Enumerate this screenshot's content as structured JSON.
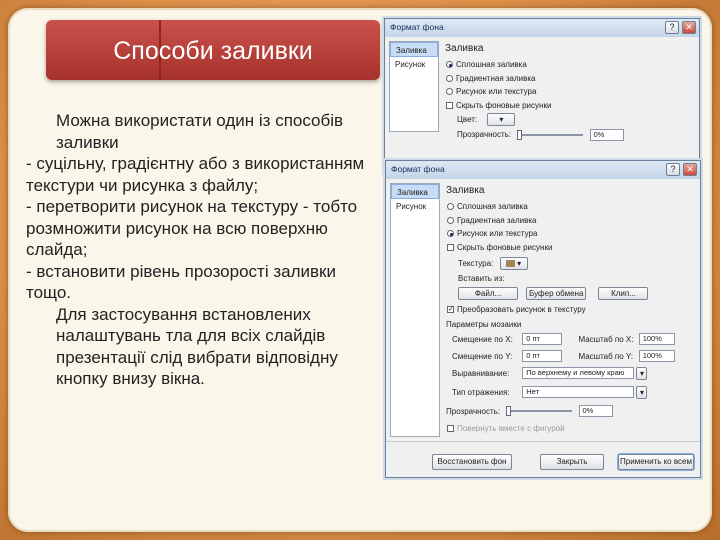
{
  "slide": {
    "title": "Способи заливки",
    "paragraphs": [
      "Можна використати один із способів заливки",
      "- суцільну, градієнтну або з використанням текстури чи рисунка з файлу;",
      "- перетворити рисунок на текстуру - тобто розмножити рисунок на всю поверхню слайда;",
      "- встановити рівень прозорості заливки тощо.",
      "Для застосування встановлених налаштувань тла для всіх слайдів презентації слід вибрати відповідну кнопку внизу вікна."
    ]
  },
  "dialog_back": {
    "title": "Формат фона",
    "sidebar": [
      "Заливка",
      "Рисунок"
    ],
    "section": "Заливка",
    "fill_options": [
      "Сплошная заливка",
      "Градиентная заливка",
      "Рисунок или текстура"
    ],
    "hide_bg": "Скрыть фоновые рисунки",
    "color_label": "Цвет:",
    "transparency_label": "Прозрачность:",
    "transparency_value": "0%",
    "close": "✕",
    "help": "?"
  },
  "dialog_front": {
    "title": "Формат фона",
    "sidebar": [
      "Заливка",
      "Рисунок"
    ],
    "section": "Заливка",
    "fill_options": [
      "Сплошная заливка",
      "Градиентная заливка",
      "Рисунок или текстура"
    ],
    "hide_bg": "Скрыть фоновые рисунки",
    "texture_label": "Текстура:",
    "insert_from": "Вставить из:",
    "btn_file": "Файл...",
    "btn_clipboard": "Буфер обмена",
    "btn_clip": "Клип...",
    "tile_label": "Преобразовать рисунок в текстуру",
    "tile_params": "Параметры мозаики",
    "offset_x_label": "Смещение по X:",
    "offset_x_value": "0 пт",
    "offset_y_label": "Смещение по Y:",
    "offset_y_value": "0 пт",
    "scale_x_label": "Масштаб по X:",
    "scale_x_value": "100%",
    "scale_y_label": "Масштаб по Y:",
    "scale_y_value": "100%",
    "align_label": "Выравнивание:",
    "align_value": "По верхнему и левому краю",
    "mirror_label": "Тип отражения:",
    "mirror_value": "Нет",
    "transparency_label": "Прозрачность:",
    "transparency_value": "0%",
    "rotate_label": "Повернуть вместе с фигурой",
    "btn_reset": "Восстановить фон",
    "btn_close": "Закрыть",
    "btn_apply_all": "Применить ко всем",
    "close": "✕",
    "help": "?"
  }
}
